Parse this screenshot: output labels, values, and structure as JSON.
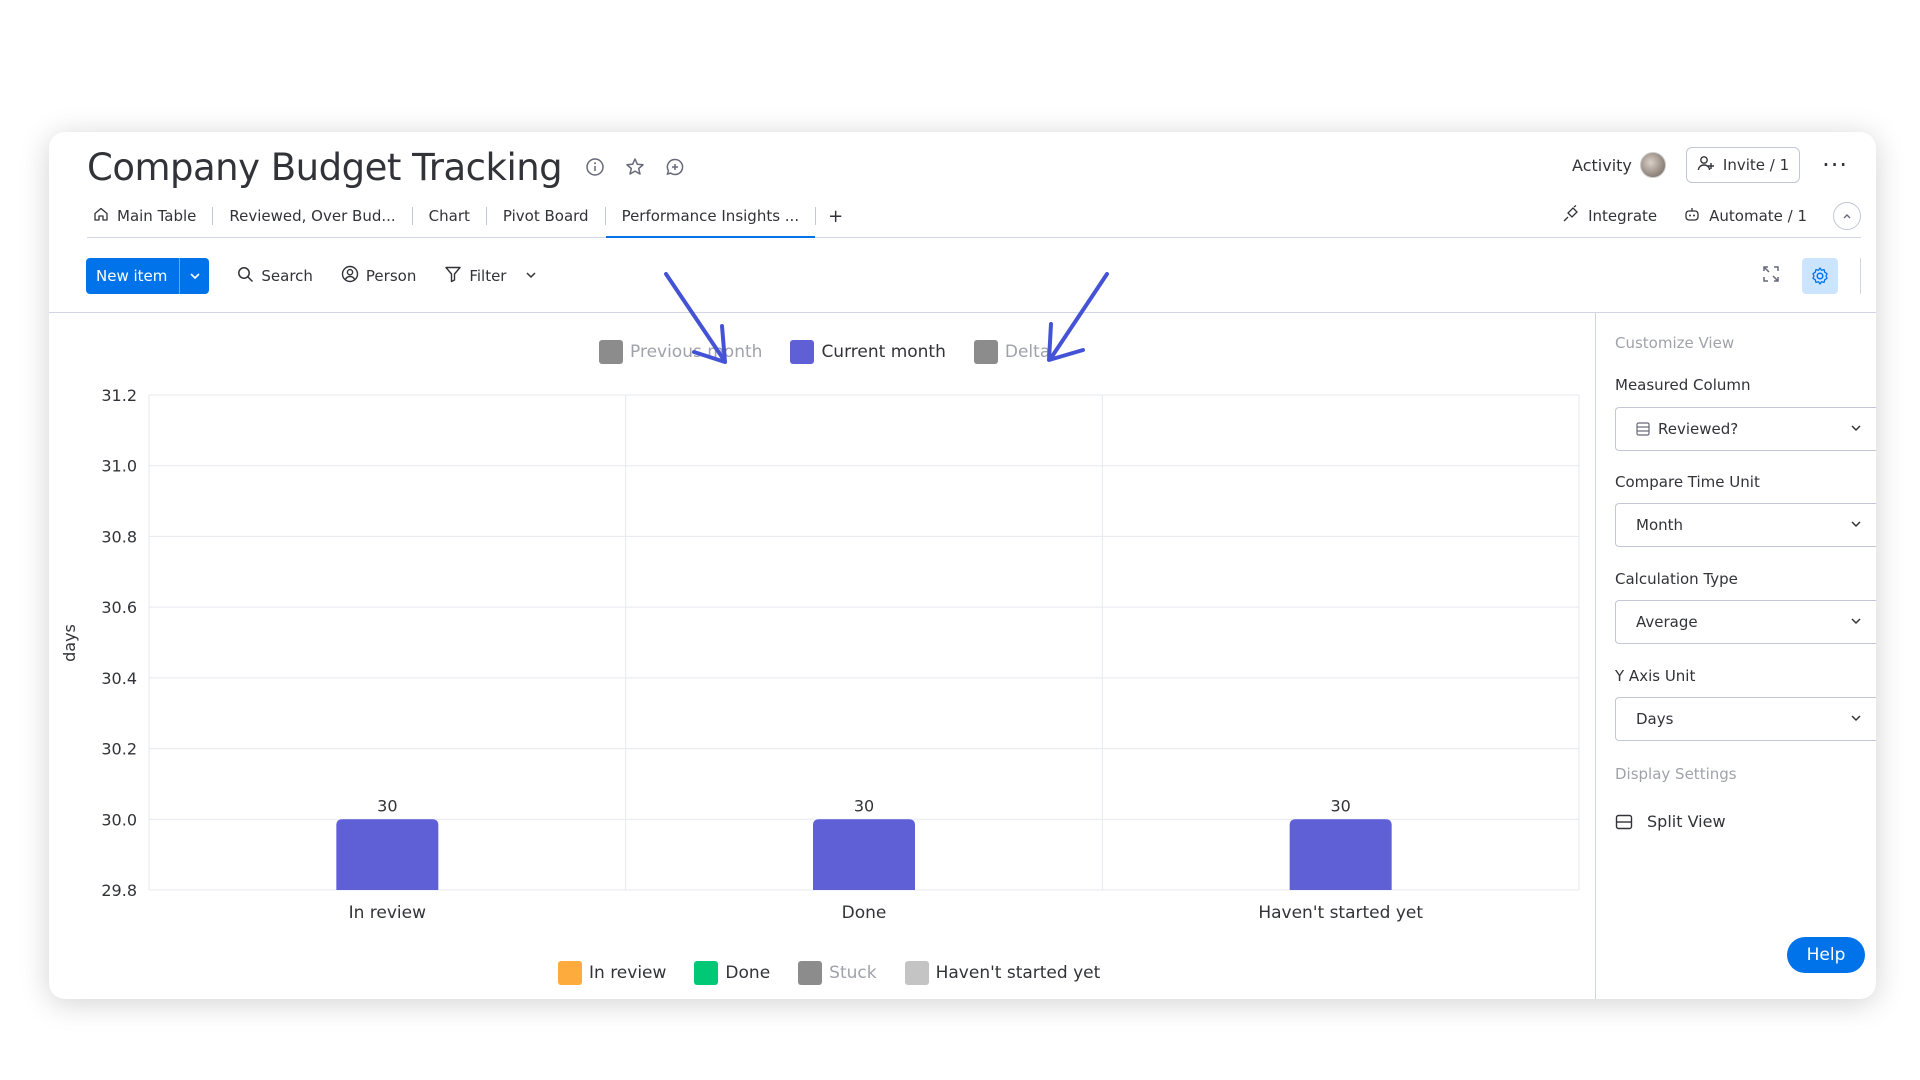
{
  "header": {
    "title": "Company Budget Tracking",
    "activity_label": "Activity",
    "invite_label": "Invite / 1",
    "more_label": "···"
  },
  "tabs": [
    {
      "label": "Main Table"
    },
    {
      "label": "Reviewed, Over Bud..."
    },
    {
      "label": "Chart"
    },
    {
      "label": "Pivot Board"
    },
    {
      "label": "Performance Insights ..."
    }
  ],
  "tab_add": "+",
  "tabs_right": {
    "integrate": "Integrate",
    "automate": "Automate / 1"
  },
  "toolbar": {
    "new_item": "New item",
    "search": "Search",
    "person": "Person",
    "filter": "Filter"
  },
  "legend_top": [
    {
      "label": "Previous month",
      "color": "#8c8c8c",
      "muted": true
    },
    {
      "label": "Current month",
      "color": "#5f5fd6",
      "muted": false
    },
    {
      "label": "Delta",
      "color": "#8c8c8c",
      "muted": true
    }
  ],
  "legend_bottom": [
    {
      "label": "In review",
      "color": "#fdab3d",
      "muted": false
    },
    {
      "label": "Done",
      "color": "#00c875",
      "muted": false
    },
    {
      "label": "Stuck",
      "color": "#8c8c8c",
      "muted": true
    },
    {
      "label": "Haven't started yet",
      "color": "#c4c4c4",
      "muted": false
    }
  ],
  "chart_data": {
    "type": "bar",
    "categories": [
      "In review",
      "Done",
      "Haven't started yet"
    ],
    "series": [
      {
        "name": "Current month",
        "values": [
          30,
          30,
          30
        ],
        "color": "#5f5fd6"
      }
    ],
    "data_labels": [
      "30",
      "30",
      "30"
    ],
    "ylabel": "days",
    "ylim": [
      29.8,
      31.2
    ],
    "yticks": [
      "29.8",
      "30.0",
      "30.2",
      "30.4",
      "30.6",
      "30.8",
      "31.0",
      "31.2"
    ],
    "grid": true
  },
  "panel": {
    "customize_view": "Customize View",
    "measured_column_label": "Measured Column",
    "measured_column_value": "Reviewed?",
    "compare_time_unit_label": "Compare Time Unit",
    "compare_time_unit_value": "Month",
    "calculation_type_label": "Calculation Type",
    "calculation_type_value": "Average",
    "y_axis_unit_label": "Y Axis Unit",
    "y_axis_unit_value": "Days",
    "display_settings": "Display Settings",
    "split_view": "Split View"
  },
  "help_label": "Help"
}
